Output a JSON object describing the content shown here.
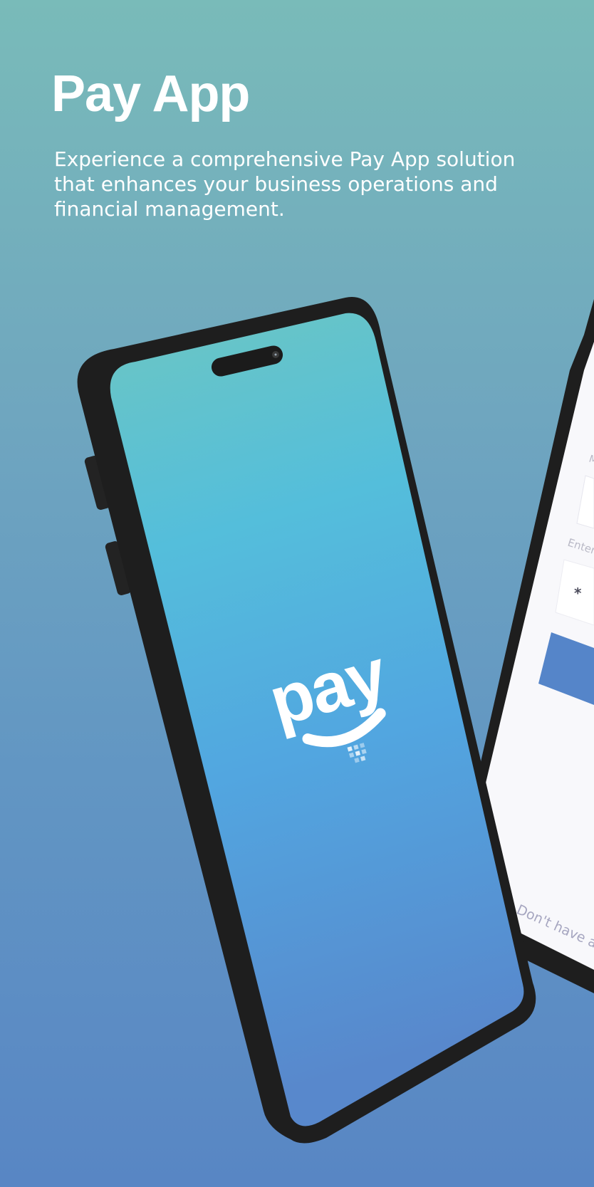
{
  "header": {
    "title": "Pay App",
    "description": "Experience a comprehensive Pay App solution that enhances your business operations and financial management."
  },
  "front_phone": {
    "logo_text": "pay",
    "screen_gradient": [
      "#6cc6c3",
      "#54bedb",
      "#52a6e0",
      "#5888cc"
    ]
  },
  "back_phone": {
    "field_label_1": "M",
    "field_label_2": "Enter",
    "password_mask": "*",
    "footer_text": "Don't have an",
    "button_color": "#5585c9"
  },
  "colors": {
    "bezel": "#1e1e1e",
    "text": "#ffffff"
  }
}
